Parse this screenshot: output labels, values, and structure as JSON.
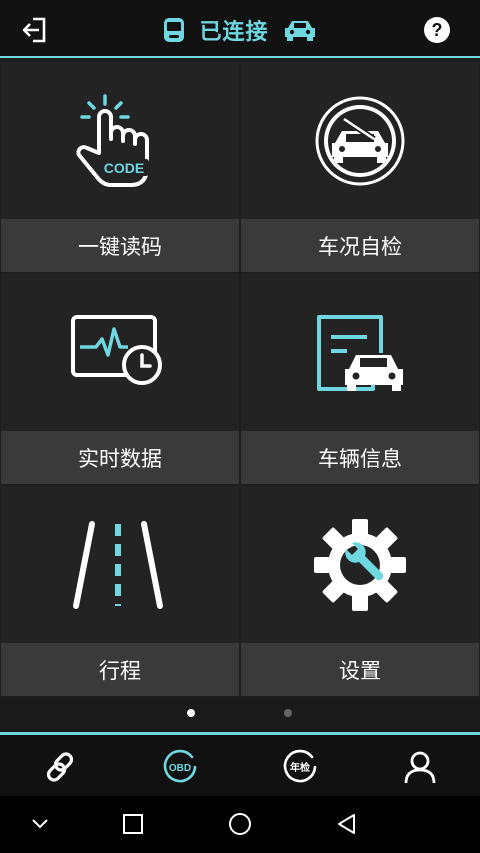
{
  "header": {
    "back_icon": "exit-arrow-icon",
    "title": "已连接",
    "left_status_icon": "phone-icon",
    "right_status_icon": "car-icon",
    "help_icon": "help-circle-icon",
    "accent_color": "#6fd7e0"
  },
  "tiles": [
    {
      "label": "一键读码",
      "icon": "tap-code-icon",
      "icon_text": "CODE"
    },
    {
      "label": "车况自检",
      "icon": "car-check-icon"
    },
    {
      "label": "实时数据",
      "icon": "monitor-clock-icon"
    },
    {
      "label": "车辆信息",
      "icon": "document-car-icon"
    },
    {
      "label": "行程",
      "icon": "road-icon"
    },
    {
      "label": "设置",
      "icon": "gear-wrench-icon"
    }
  ],
  "pager": {
    "pages": 2,
    "active": 1
  },
  "tabbar": [
    {
      "icon": "link-icon",
      "active": false
    },
    {
      "icon": "obd-icon",
      "text": "OBD",
      "active": true
    },
    {
      "icon": "annual-inspection-icon",
      "text": "年检",
      "active": false
    },
    {
      "icon": "user-icon",
      "active": false
    }
  ],
  "sysnav": [
    {
      "icon": "chevron-down-icon"
    },
    {
      "icon": "recents-square-icon"
    },
    {
      "icon": "home-circle-icon"
    },
    {
      "icon": "back-triangle-icon"
    }
  ]
}
